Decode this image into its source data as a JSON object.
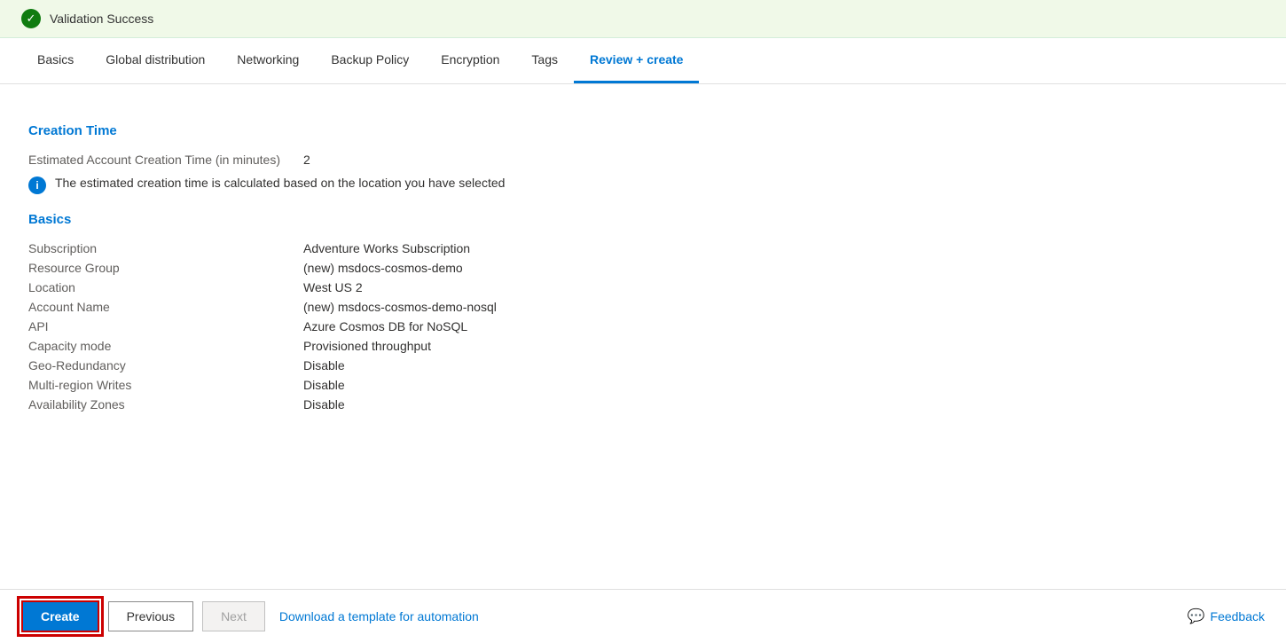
{
  "validation": {
    "icon": "✓",
    "text": "Validation Success"
  },
  "tabs": [
    {
      "id": "basics",
      "label": "Basics",
      "active": false
    },
    {
      "id": "global-distribution",
      "label": "Global distribution",
      "active": false
    },
    {
      "id": "networking",
      "label": "Networking",
      "active": false
    },
    {
      "id": "backup-policy",
      "label": "Backup Policy",
      "active": false
    },
    {
      "id": "encryption",
      "label": "Encryption",
      "active": false
    },
    {
      "id": "tags",
      "label": "Tags",
      "active": false
    },
    {
      "id": "review-create",
      "label": "Review + create",
      "active": true
    }
  ],
  "creation_time": {
    "section_title": "Creation Time",
    "rows": [
      {
        "label": "Estimated Account Creation Time (in minutes)",
        "value": "2"
      }
    ],
    "note": "The estimated creation time is calculated based on the location you have selected"
  },
  "basics": {
    "section_title": "Basics",
    "rows": [
      {
        "label": "Subscription",
        "value": "Adventure Works Subscription"
      },
      {
        "label": "Resource Group",
        "value": "(new) msdocs-cosmos-demo"
      },
      {
        "label": "Location",
        "value": "West US 2"
      },
      {
        "label": "Account Name",
        "value": "(new) msdocs-cosmos-demo-nosql"
      },
      {
        "label": "API",
        "value": "Azure Cosmos DB for NoSQL"
      },
      {
        "label": "Capacity mode",
        "value": "Provisioned throughput"
      },
      {
        "label": "Geo-Redundancy",
        "value": "Disable"
      },
      {
        "label": "Multi-region Writes",
        "value": "Disable"
      },
      {
        "label": "Availability Zones",
        "value": "Disable"
      }
    ]
  },
  "footer": {
    "create_label": "Create",
    "previous_label": "Previous",
    "next_label": "Next",
    "automation_link": "Download a template for automation",
    "feedback_label": "Feedback"
  }
}
